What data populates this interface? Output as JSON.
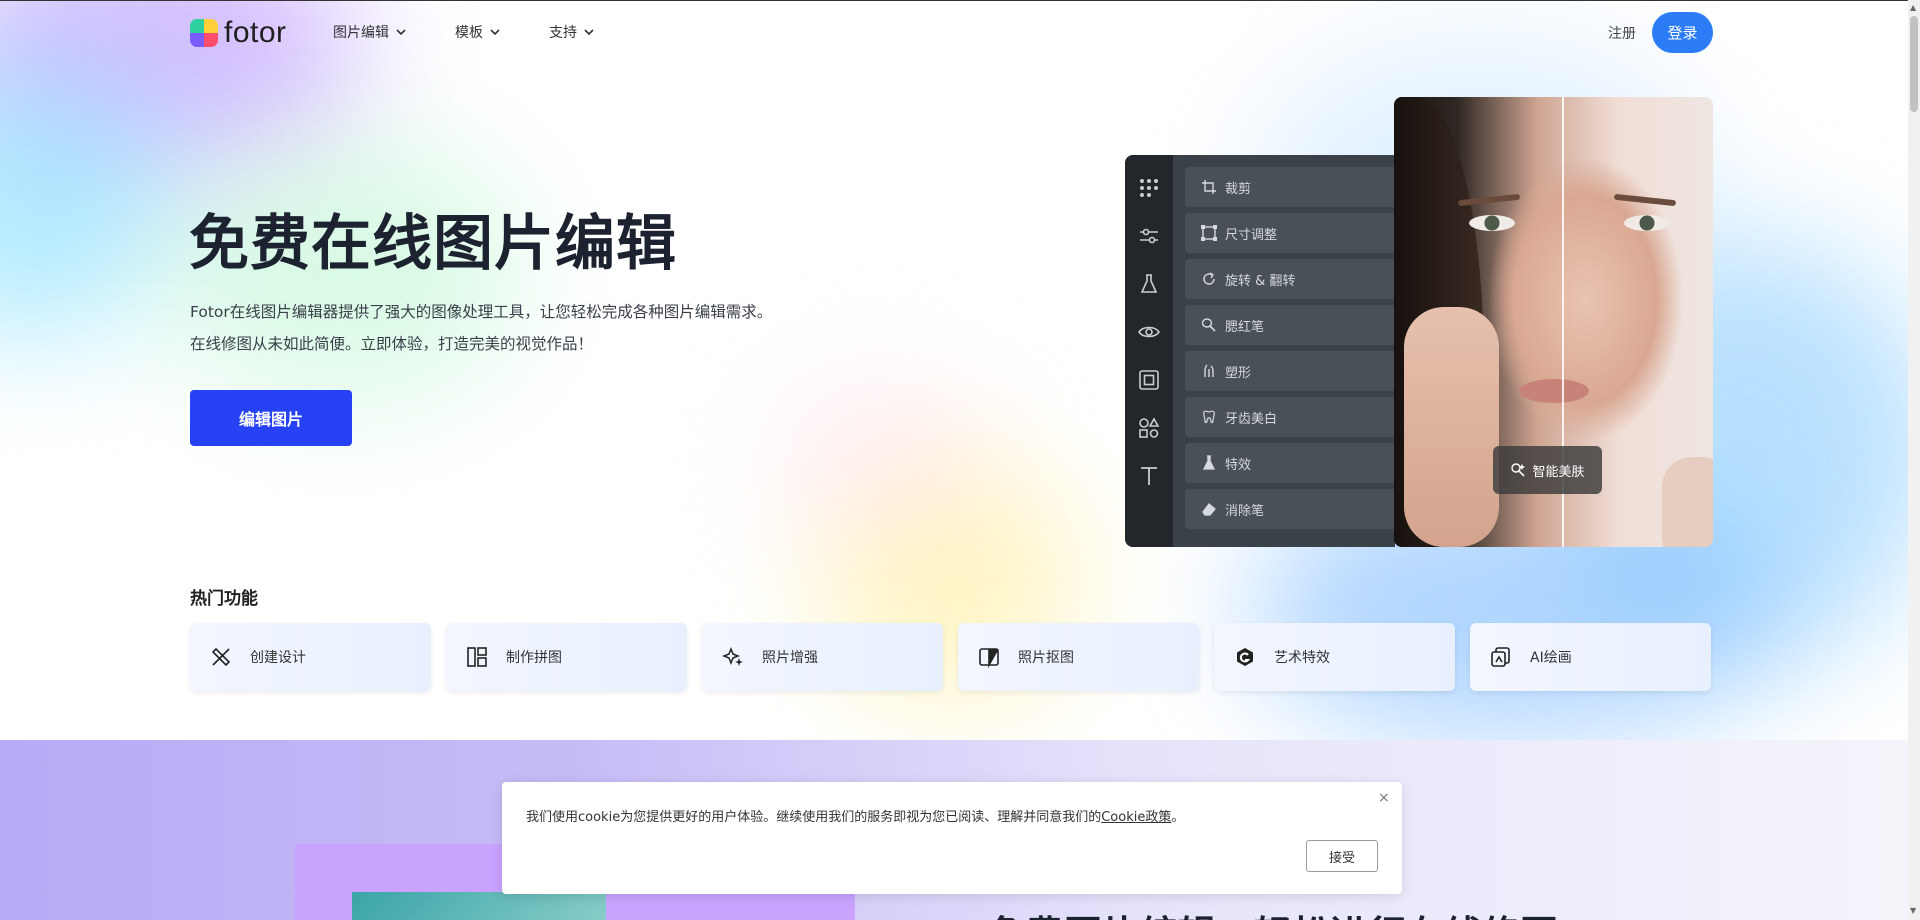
{
  "header": {
    "logo_text": "fotor",
    "nav": [
      {
        "label": "图片编辑"
      },
      {
        "label": "模板"
      },
      {
        "label": "支持"
      }
    ],
    "signup": "注册",
    "login": "登录"
  },
  "hero": {
    "title": "免费在线图片编辑",
    "desc_line1": "Fotor在线图片编辑器提供了强大的图像处理工具，让您轻松完成各种图片编辑需求。",
    "desc_line2": "在线修图从未如此简便。立即体验，打造完美的视觉作品！",
    "cta": "编辑图片"
  },
  "editor": {
    "tools": [
      "裁剪",
      "尺寸调整",
      "旋转 & 翻转",
      "腮红笔",
      "塑形",
      "牙齿美白",
      "特效",
      "消除笔"
    ],
    "beauty_chip": "智能美肤"
  },
  "hot_features": {
    "label": "热门功能",
    "items": [
      "创建设计",
      "制作拼图",
      "照片增强",
      "照片抠图",
      "艺术特效",
      "AI绘画"
    ]
  },
  "lower": {
    "heading": "免费图片编辑，轻松进行在线修图"
  },
  "cookie": {
    "text": "我们使用cookie为您提供更好的用户体验。继续使用我们的服务即视为您已阅读、理解并同意我们的",
    "link": "Cookie政策",
    "period": "。",
    "close": "×",
    "accept": "接受"
  },
  "colors": {
    "accent_login": "#2b7cf6",
    "cta": "#2742f5"
  }
}
